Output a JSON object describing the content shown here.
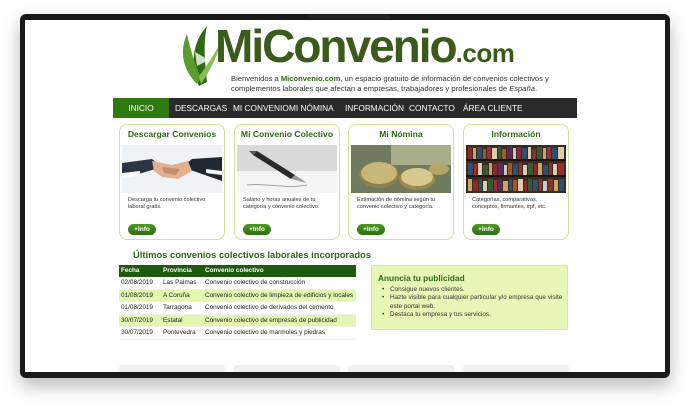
{
  "brand": {
    "logo_main": "MiConvenio",
    "logo_suffix": ".com",
    "tagline_prefix": "Bienvenidos a ",
    "tagline_site": "Miconvenio.com",
    "tagline_rest": ", un espacio gratuito de información de convenios colectivos y complementos laborales que afectan a empresas, trabajadores y profesionales de ",
    "tagline_country": "España",
    "tagline_end": "."
  },
  "nav": {
    "items": [
      "INICIO",
      "DESCARGAS",
      "MI CONVENIO",
      "MI NÓMINA",
      "INFORMACIÓN",
      "CONTACTO",
      "ÁREA CLIENTE"
    ],
    "active": "INICIO"
  },
  "cards": [
    {
      "title": "Descargar Convenios",
      "text": "Descarga tu convenio colectivo laboral gratis.",
      "button": "+Info",
      "image": "handshake-image"
    },
    {
      "title": "Mi Convenio Colectivo",
      "text": "Salario y horas anuales de tu categoría y convenio colectivo.",
      "button": "+Info",
      "image": "fountain-pen-image"
    },
    {
      "title": "Mi Nómina",
      "text": "Estimación de nómina según tu convenio colectivo y categoría.",
      "button": "+Info",
      "image": "coins-image"
    },
    {
      "title": "Información",
      "text": "Categorías, comparativas, conceptos, firmantes, irpf, etc.",
      "button": "+Info",
      "image": "bookshelf-image"
    }
  ],
  "latest": {
    "title": "Últimos convenios colectivos laborales incorporados",
    "columns": [
      "Fecha",
      "Provincia",
      "Convenio colectivo"
    ],
    "rows": [
      {
        "fecha": "02/08/2019",
        "provincia": "Las Palmas",
        "convenio": "Convenio colectivo de construcción",
        "highlight": false
      },
      {
        "fecha": "01/08/2019",
        "provincia": "A Coruña",
        "convenio": "Convenio colectivo de limpieza de edificios y locales",
        "highlight": true
      },
      {
        "fecha": "01/08/2019",
        "provincia": "Tarragona",
        "convenio": "Convenio colectivo de derivados del cemento",
        "highlight": false
      },
      {
        "fecha": "30/07/2019",
        "provincia": "Estatal",
        "convenio": "Convenio colectivo de empresas de publicidad",
        "highlight": true
      },
      {
        "fecha": "30/07/2019",
        "provincia": "Pontevedra",
        "convenio": "Convenio colectivo de marmoles y piedras",
        "highlight": false
      }
    ]
  },
  "ad": {
    "title": "Anuncia tu publicidad",
    "items": [
      "Consigue nuevos clientes.",
      "Hazte visible para cualquier particular y/o empresa que visite este portal web.",
      "Destaca tu empresa y tus servicios."
    ]
  },
  "colors": {
    "brand_green": "#2d6a12",
    "nav_bg": "#2a2a2a",
    "nav_active": "#2d7a10",
    "highlight_row": "#e2f7b0",
    "ad_bg": "#e6f7b6"
  }
}
